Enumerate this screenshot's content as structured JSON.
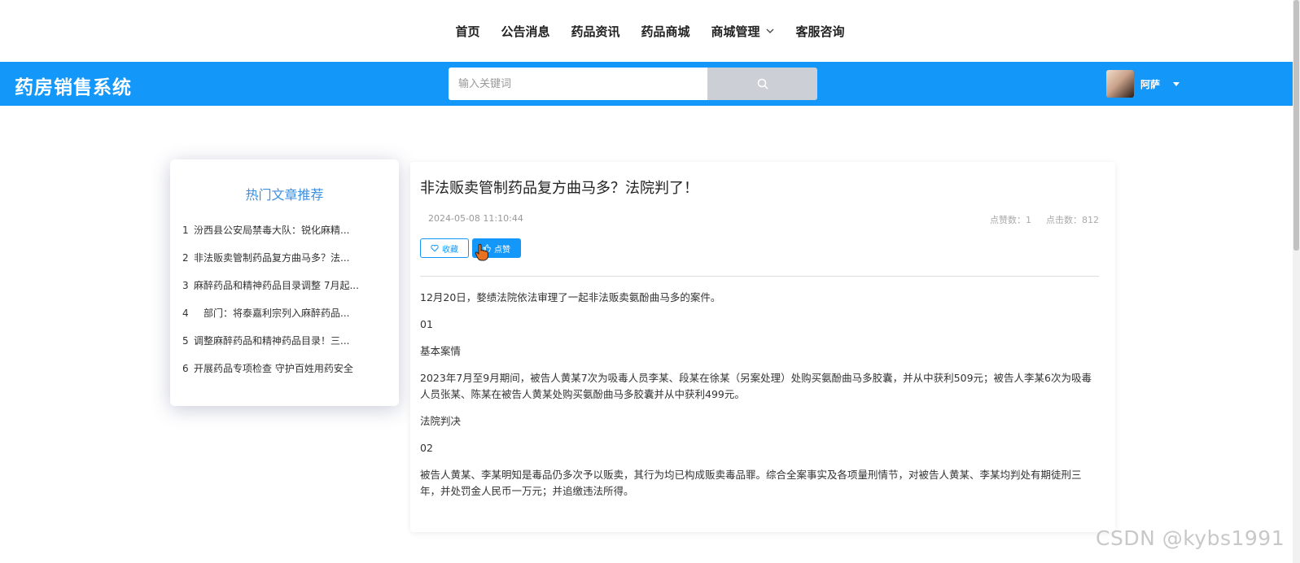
{
  "nav": {
    "items": [
      {
        "label": "首页"
      },
      {
        "label": "公告消息"
      },
      {
        "label": "药品资讯"
      },
      {
        "label": "药品商城"
      },
      {
        "label": "商城管理"
      },
      {
        "label": "客服咨询"
      }
    ]
  },
  "header": {
    "site_title": "药房销售系统",
    "search_placeholder": "输入关键词",
    "user_name": "阿萨"
  },
  "hot": {
    "title": "热门文章推荐",
    "items": [
      {
        "num": "1",
        "text": "汾西县公安局禁毒大队：锐化麻精..."
      },
      {
        "num": "2",
        "text": "非法贩卖管制药品复方曲马多？法..."
      },
      {
        "num": "3",
        "text": "麻醉药品和精神药品目录调整 7月起..."
      },
      {
        "num": "4",
        "text": "　部门：将泰嘉利宗列入麻醉药品..."
      },
      {
        "num": "5",
        "text": "调整麻醉药品和精神药品目录！三..."
      },
      {
        "num": "6",
        "text": "开展药品专项检查 守护百姓用药安全"
      }
    ]
  },
  "article": {
    "title": "非法贩卖管制药品复方曲马多？法院判了！",
    "date": "2024-05-08 11:10:44",
    "likes_text": "点赞数：1",
    "clicks_text": "点击数：812",
    "fav_label": "收藏",
    "like_label": "点赞",
    "paragraphs": [
      "12月20日，婺绩法院依法审理了一起非法贩卖氨酚曲马多的案件。",
      "01",
      "基本案情",
      "2023年7月至9月期间，被告人黄某7次为吸毒人员李某、段某在徐某（另案处理）处购买氨酚曲马多胶囊，并从中获利509元；被告人李某6次为吸毒人员张某、陈某在被告人黄某处购买氨酚曲马多胶囊并从中获利499元。",
      "法院判决",
      "02",
      "被告人黄某、李某明知是毒品仍多次予以贩卖，其行为均已构成贩卖毒品罪。综合全案事实及各项量刑情节，对被告人黄某、李某均判处有期徒刑三年，并处罚金人民币一万元；并追缴违法所得。"
    ]
  },
  "watermark": "CSDN @kybs1991",
  "colors": {
    "brand_blue": "#1397f9",
    "hot_title": "#3d8fe0",
    "search_button": "#ccd0d6"
  }
}
